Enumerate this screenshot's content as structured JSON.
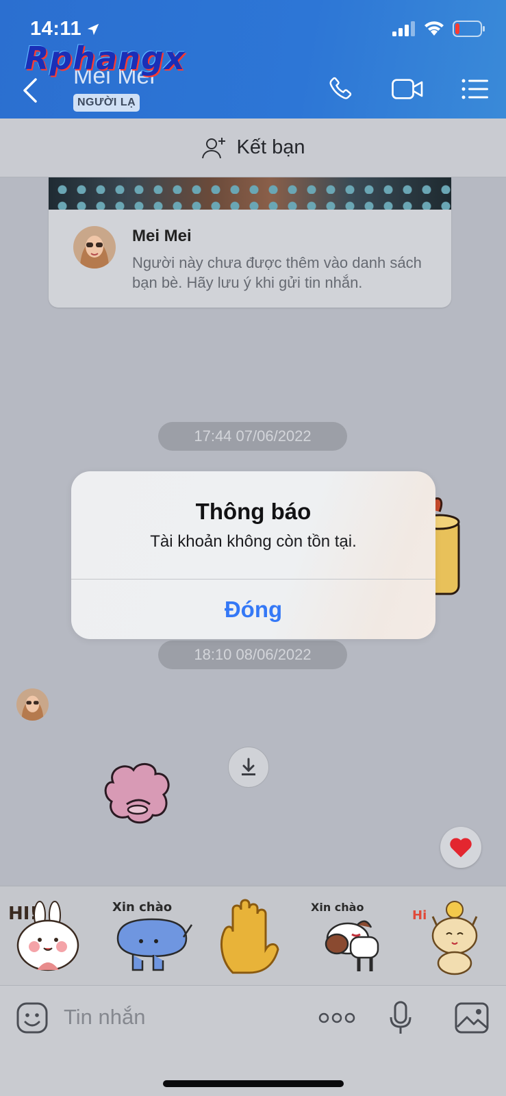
{
  "status_bar": {
    "time": "14:11"
  },
  "watermark": "Rphangx",
  "header": {
    "contact_name": "Mei Mei",
    "badge": "NGƯỜI LẠ"
  },
  "add_friend": {
    "label": "Kết bạn"
  },
  "profile_card": {
    "name": "Mei Mei",
    "text": "Người này chưa được thêm vào danh sách bạn bè. Hãy lưu ý khi gửi tin nhắn."
  },
  "timestamps": [
    "17:44 07/06/2022",
    "18:10 08/06/2022"
  ],
  "stickers": [
    {
      "caption": "HI!"
    },
    {
      "caption": "Xin chào"
    },
    {
      "caption": ""
    },
    {
      "caption": "Xin chào"
    },
    {
      "caption": "Hi"
    }
  ],
  "composer": {
    "placeholder": "Tin nhắn"
  },
  "dialog": {
    "title": "Thông báo",
    "message": "Tài khoản không còn tồn tại.",
    "button": "Đóng"
  },
  "colors": {
    "header_blue": "#2d76d6",
    "accent": "#3478f6",
    "heart": "#e3262f"
  }
}
